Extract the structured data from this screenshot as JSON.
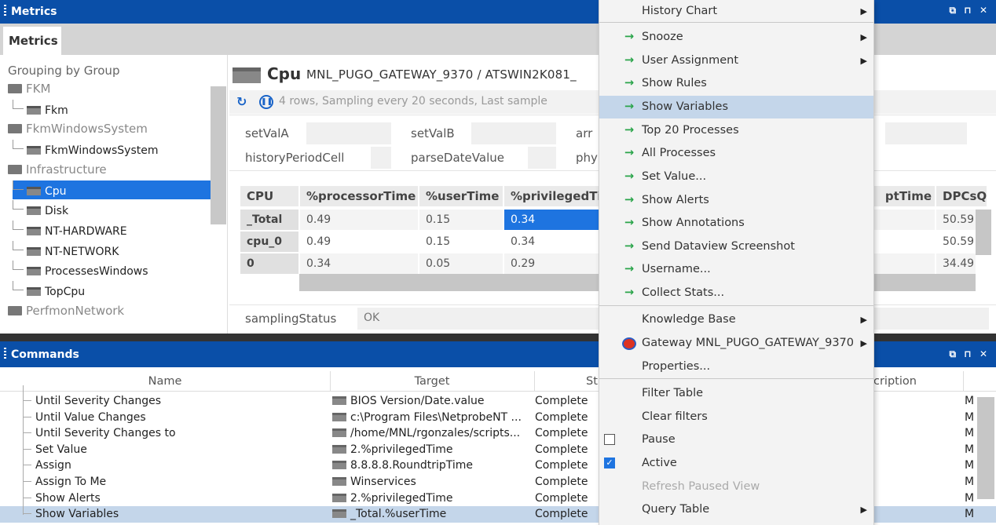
{
  "metrics": {
    "title": "Metrics",
    "tab": "Metrics",
    "win_controls": "⧉ ⊓ ✕"
  },
  "tree": {
    "header": "Grouping by Group",
    "items": [
      {
        "label": "FKM",
        "type": "group"
      },
      {
        "label": "Fkm",
        "type": "leaf"
      },
      {
        "label": "FkmWindowsSystem",
        "type": "group"
      },
      {
        "label": "FkmWindowsSystem",
        "type": "leaf"
      },
      {
        "label": "Infrastructure",
        "type": "group"
      },
      {
        "label": "Cpu",
        "type": "leaf",
        "selected": true
      },
      {
        "label": "Disk",
        "type": "leaf"
      },
      {
        "label": "NT-HARDWARE",
        "type": "leaf"
      },
      {
        "label": "NT-NETWORK",
        "type": "leaf"
      },
      {
        "label": "ProcessesWindows",
        "type": "leaf"
      },
      {
        "label": "TopCpu",
        "type": "leaf"
      },
      {
        "label": "PerfmonNetwork",
        "type": "group"
      }
    ]
  },
  "dataview": {
    "name": "Cpu",
    "path": "MNL_PUGO_GATEWAY_9370 / ATSWIN2K081_",
    "status": "4 rows, Sampling every 20 seconds, Last sample",
    "headlines": [
      {
        "label": "setValA",
        "value": ""
      },
      {
        "label": "setValB",
        "value": ""
      },
      {
        "label": "arr",
        "value": ""
      },
      {
        "label": "historyPeriodCell",
        "value": ""
      },
      {
        "label": "parseDateValue",
        "value": ""
      },
      {
        "label": "phy",
        "value": ""
      }
    ],
    "columns": [
      "CPU",
      "%processorTime",
      "%userTime",
      "%privilegedTi",
      "ptTime",
      "DPCsQ"
    ],
    "rows": [
      {
        "name": "_Total",
        "values": [
          "0.49",
          "0.15",
          "0.34"
        ],
        "dpc": "50.59"
      },
      {
        "name": "cpu_0",
        "values": [
          "0.49",
          "0.15",
          "0.34"
        ],
        "dpc": "50.59"
      },
      {
        "name": "0",
        "values": [
          "0.34",
          "0.05",
          "0.29"
        ],
        "dpc": "34.49"
      }
    ],
    "sampling_label": "samplingStatus",
    "sampling_value": "OK"
  },
  "commands": {
    "title": "Commands",
    "columns": [
      "Name",
      "Target",
      "St",
      "cription"
    ],
    "rows": [
      {
        "name": "Until Severity Changes",
        "target": "BIOS Version/Date.value",
        "status": "Complete",
        "desc": "M"
      },
      {
        "name": "Until Value Changes",
        "target": "c:\\Program Files\\NetprobeNT ...",
        "status": "Complete",
        "desc": "M"
      },
      {
        "name": "Until Severity Changes to",
        "target": "/home/MNL/rgonzales/scripts...",
        "status": "Complete",
        "desc": "M"
      },
      {
        "name": "Set Value",
        "target": "2.%privilegedTime",
        "status": "Complete",
        "desc": "M"
      },
      {
        "name": "Assign",
        "target": "8.8.8.8.RoundtripTime",
        "status": "Complete",
        "desc": "M"
      },
      {
        "name": "Assign To Me",
        "target": "Winservices",
        "status": "Complete",
        "desc": "M"
      },
      {
        "name": "Show Alerts",
        "target": "2.%privilegedTime",
        "status": "Complete",
        "desc": "M"
      },
      {
        "name": "Show Variables",
        "target": "_Total.%userTime",
        "status": "Complete",
        "desc": "M"
      }
    ]
  },
  "menu": {
    "items": [
      {
        "label": "History Chart",
        "arrow": false,
        "sub": true
      },
      {
        "label": "Snooze",
        "arrow": true,
        "sub": true
      },
      {
        "label": "User Assignment",
        "arrow": true,
        "sub": true
      },
      {
        "label": "Show Rules",
        "arrow": true
      },
      {
        "label": "Show Variables",
        "arrow": true,
        "highlight": true
      },
      {
        "label": "Top 20 Processes",
        "arrow": true
      },
      {
        "label": "All Processes",
        "arrow": true
      },
      {
        "label": "Set Value...",
        "arrow": true
      },
      {
        "label": "Show Alerts",
        "arrow": true
      },
      {
        "label": "Show Annotations",
        "arrow": true
      },
      {
        "label": "Send Dataview Screenshot",
        "arrow": true
      },
      {
        "label": "Username...",
        "arrow": true
      },
      {
        "label": "Collect Stats...",
        "arrow": true
      },
      {
        "label": "Knowledge Base",
        "sub": true
      },
      {
        "label": "Gateway MNL_PUGO_GATEWAY_9370",
        "sub": true,
        "icon": true
      },
      {
        "label": "Properties..."
      },
      {
        "label": "Filter Table"
      },
      {
        "label": "Clear filters"
      },
      {
        "label": "Pause",
        "check": "off"
      },
      {
        "label": "Active",
        "check": "on"
      },
      {
        "label": "Refresh Paused View",
        "disabled": true
      },
      {
        "label": "Query Table",
        "sub": true
      }
    ]
  },
  "colors": {
    "titlebar": "#0a4fa8",
    "selection": "#1e74e0",
    "menu_highlight": "#c4d6ea",
    "arrow": "#2aa44a"
  }
}
